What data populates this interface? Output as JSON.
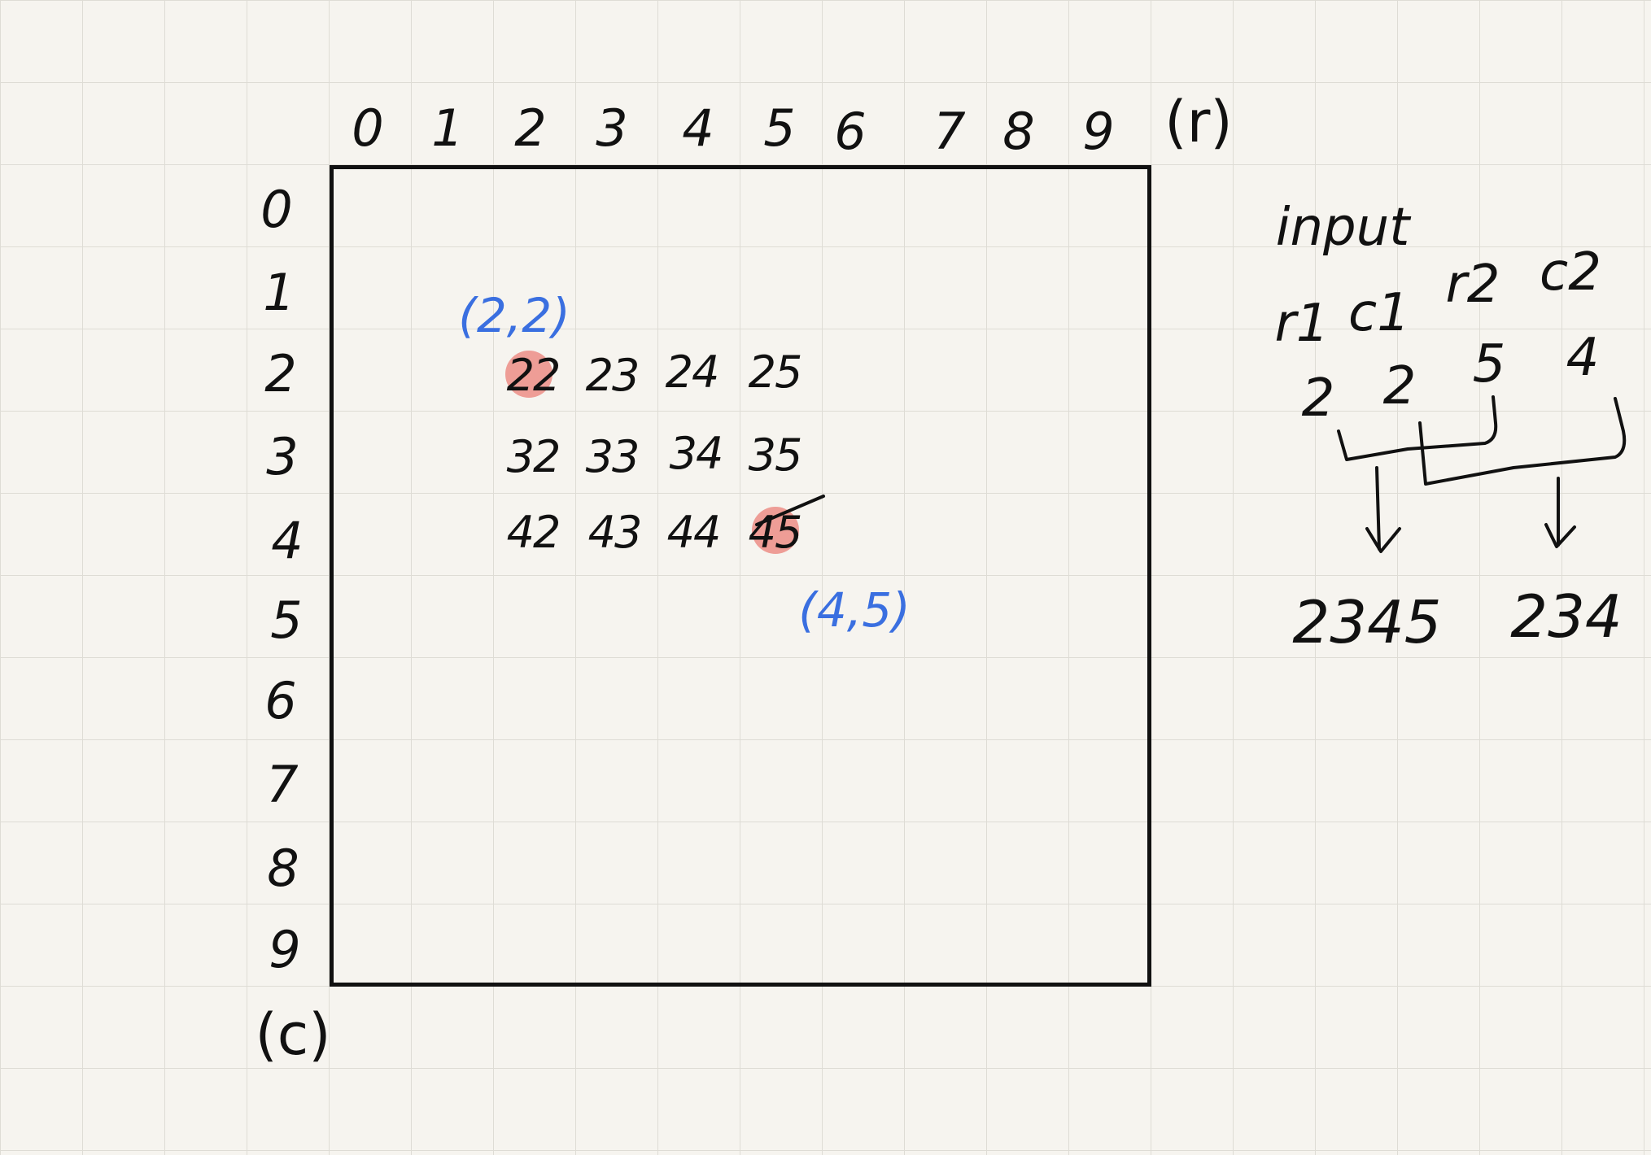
{
  "column_axis": {
    "labels": [
      "0",
      "1",
      "2",
      "3",
      "4",
      "5",
      "6",
      "7",
      "8",
      "9"
    ],
    "name": "(r)"
  },
  "row_axis": {
    "labels": [
      "0",
      "1",
      "2",
      "3",
      "4",
      "5",
      "6",
      "7",
      "8",
      "9"
    ],
    "name": "(c)"
  },
  "cells": {
    "row2": [
      "22",
      "23",
      "24",
      "25"
    ],
    "row3": [
      "32",
      "33",
      "34",
      "35"
    ],
    "row4": [
      "42",
      "43",
      "44",
      "45"
    ]
  },
  "start_coord": "(2,2)",
  "end_coord": "(4,5)",
  "colors": {
    "ink": "#111111",
    "blue": "#3a6fe0",
    "highlight": "#ec8d86",
    "grid": "#dedcd5"
  },
  "input": {
    "title": "input",
    "headers": [
      "r1",
      "c1",
      "r2",
      "c2"
    ],
    "values": [
      "2",
      "2",
      "5",
      "4"
    ],
    "results": [
      "2345",
      "234"
    ]
  }
}
